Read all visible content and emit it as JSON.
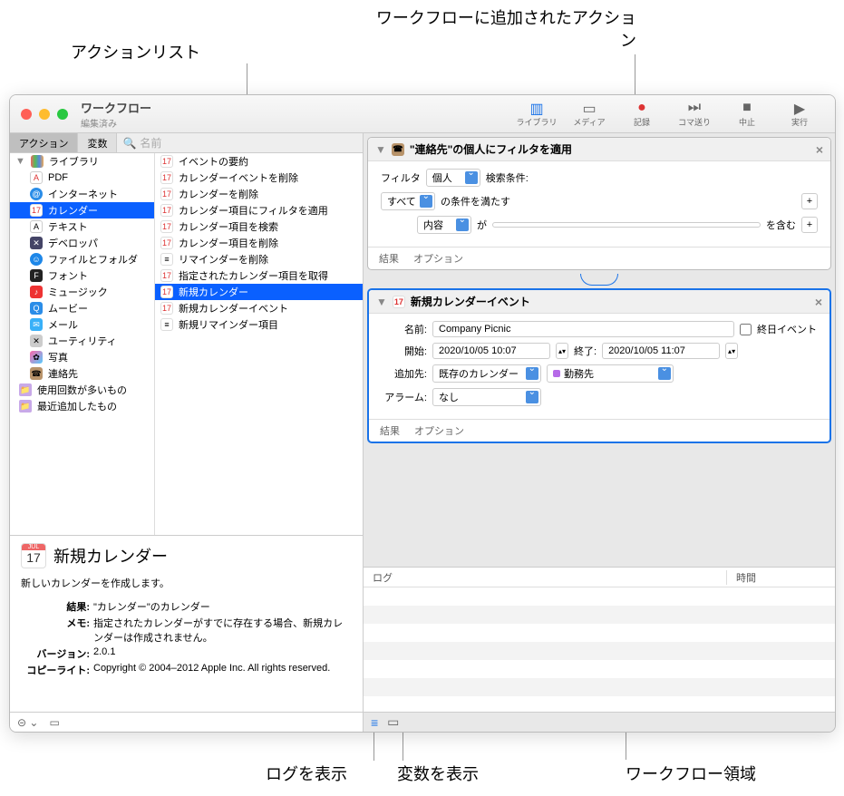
{
  "callouts": {
    "action_list": "アクションリスト",
    "added_action": "ワークフローに追加されたアクション",
    "show_log": "ログを表示",
    "show_vars": "変数を表示",
    "workflow_area": "ワークフロー領域"
  },
  "window": {
    "title": "ワークフロー",
    "subtitle": "編集済み"
  },
  "toolbar": {
    "library": "ライブラリ",
    "media": "メディア",
    "record": "記録",
    "step": "コマ送り",
    "stop": "中止",
    "run": "実行"
  },
  "tabs": {
    "actions": "アクション",
    "variables": "変数"
  },
  "search": {
    "placeholder": "名前"
  },
  "library": {
    "root": "ライブラリ",
    "items": [
      "PDF",
      "インターネット",
      "カレンダー",
      "テキスト",
      "デベロッパ",
      "ファイルとフォルダ",
      "フォント",
      "ミュージック",
      "ムービー",
      "メール",
      "ユーティリティ",
      "写真",
      "連絡先"
    ],
    "selected": 2,
    "smart": [
      "使用回数が多いもの",
      "最近追加したもの"
    ]
  },
  "actions": {
    "items": [
      "イベントの要約",
      "カレンダーイベントを削除",
      "カレンダーを削除",
      "カレンダー項目にフィルタを適用",
      "カレンダー項目を検索",
      "カレンダー項目を削除",
      "リマインダーを削除",
      "指定されたカレンダー項目を取得",
      "新規カレンダー",
      "新規カレンダーイベント",
      "新規リマインダー項目"
    ],
    "selected": 8
  },
  "info": {
    "title": "新規カレンダー",
    "desc": "新しいカレンダーを作成します。",
    "result_k": "結果:",
    "result_v": "\"カレンダー\"のカレンダー",
    "memo_k": "メモ:",
    "memo_v": "指定されたカレンダーがすでに存在する場合、新規カレンダーは作成されません。",
    "ver_k": "バージョン:",
    "ver_v": "2.0.1",
    "copy_k": "コピーライト:",
    "copy_v": "Copyright © 2004–2012 Apple Inc.  All rights reserved.",
    "cal_month": "JUL",
    "cal_day": "17"
  },
  "wf_action1": {
    "title": "\"連絡先\"の個人にフィルタを適用",
    "filter_lbl": "フィルタ",
    "filter_val": "個人",
    "search_lbl": "検索条件:",
    "all_val": "すべて",
    "cond_suffix": "の条件を満たす",
    "content_val": "内容",
    "ga": "が",
    "wo_fukumu": "を含む",
    "result": "結果",
    "options": "オプション"
  },
  "wf_action2": {
    "title": "新規カレンダーイベント",
    "name_lbl": "名前:",
    "name_val": "Company Picnic",
    "allday": "終日イベント",
    "start_lbl": "開始:",
    "start_val": "2020/10/05 10:07",
    "end_lbl": "終了:",
    "end_val": "2020/10/05 11:07",
    "addto_lbl": "追加先:",
    "addto_val": "既存のカレンダー",
    "cal_val": "勤務先",
    "alarm_lbl": "アラーム:",
    "alarm_val": "なし",
    "result": "結果",
    "options": "オプション"
  },
  "log": {
    "col1": "ログ",
    "col2": "時間"
  }
}
